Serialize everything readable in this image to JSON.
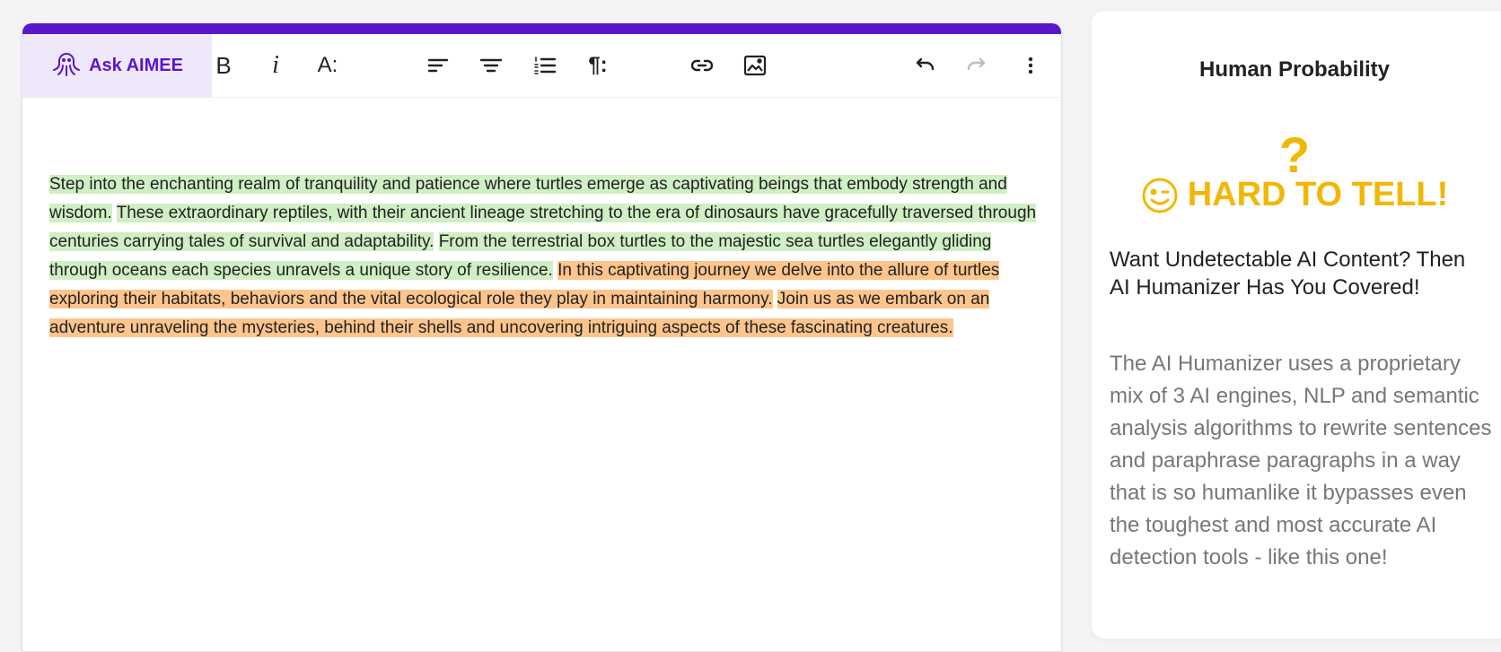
{
  "toolbar": {
    "ask_label": "Ask AIMEE",
    "bold": "B",
    "italic": "i",
    "font_size": "A:",
    "paragraph": "¶:"
  },
  "editor": {
    "sentences": [
      {
        "text": "Step into the enchanting realm of tranquility and patience where turtles emerge as captivating beings that embody strength and wisdom.",
        "highlight": "green"
      },
      {
        "text": "These extraordinary reptiles, with their ancient lineage stretching to the era of dinosaurs have gracefully traversed through centuries carrying tales of survival and adaptability.",
        "highlight": "green"
      },
      {
        "text": "From the terrestrial box turtles to the majestic sea turtles elegantly gliding through oceans each species unravels a unique story of resilience.",
        "highlight": "green"
      },
      {
        "text": "In this captivating journey we delve into the allure of turtles exploring their habitats, behaviors and the vital ecological role they play in maintaining harmony.",
        "highlight": "orange"
      },
      {
        "text": "Join us as we embark on an adventure unraveling the mysteries, behind their shells and uncovering intriguing aspects of these fascinating creatures.",
        "highlight": "orange"
      }
    ]
  },
  "sidebar": {
    "title": "Human Probability",
    "question_mark": "?",
    "verdict": "HARD TO TELL!",
    "promo_heading": "Want Undetectable AI Content? Then AI Humanizer Has You Covered!",
    "promo_body": "The AI Humanizer uses a proprietary mix of 3 AI engines, NLP and semantic analysis algorithms to rewrite sentences and paraphrase paragraphs in a way that is so humanlike it bypasses even the toughest and most accurate AI detection tools - like this one!"
  },
  "colors": {
    "brand": "#5a16c9",
    "verdict": "#f2b705",
    "highlight_green": "#cfefc4",
    "highlight_orange": "#fdc58c"
  },
  "icons": [
    "octopus-icon",
    "align-left-icon",
    "align-center-icon",
    "numbered-list-icon",
    "link-icon",
    "image-icon",
    "undo-icon",
    "redo-icon",
    "more-vertical-icon",
    "wink-face-icon"
  ]
}
